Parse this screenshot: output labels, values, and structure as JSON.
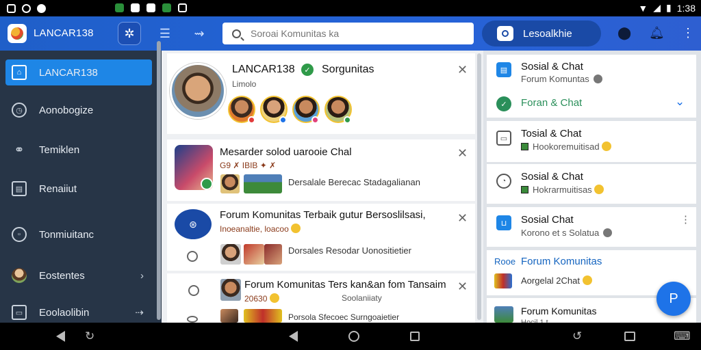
{
  "status_bar": {
    "time": "1:38"
  },
  "app_bar": {
    "title": "LANCAR138",
    "search_placeholder": "Soroai Komunitas ka",
    "pill_label": "Lesoalkhie"
  },
  "sidebar": {
    "items": [
      {
        "label": "LANCAR138",
        "icon": "home-icon",
        "active": true
      },
      {
        "label": "Aonobogize",
        "icon": "clock-icon"
      },
      {
        "label": "Temiklen",
        "icon": "link-icon"
      },
      {
        "label": "Renaiiut",
        "icon": "calendar-icon"
      },
      {
        "label": "Tonmiuitanc",
        "icon": "box-icon"
      },
      {
        "label": "Eostentes",
        "icon": "avatar",
        "chevron": "›"
      },
      {
        "label": "Eoolaolibin",
        "icon": "tablet-icon",
        "chevron": "⇢"
      }
    ]
  },
  "profile": {
    "name": "LANCAR138",
    "group": "Sorgunitas",
    "subtitle": "Limolo"
  },
  "posts": [
    {
      "title": "Mesarder solod uarooie Chal",
      "meta": "G9 ✗ IBIB ✦ ✗",
      "desc": "Dersalale Berecac Stadagalianan"
    },
    {
      "title": "Forum Komunitas Terbaik gutur Bersoslilsasi,",
      "meta": "Inoeanaltie, loacoo",
      "desc": "Dorsales Resodar Uonositietier"
    },
    {
      "title": "Forum Komunitas Ters kan&an fom Tansaim",
      "meta": "20630",
      "meta2": "Soolaniiaty",
      "desc": "Porsola Sfecoec Surngoaietier"
    }
  ],
  "right_panel": {
    "card1": {
      "title": "Sosial & Chat",
      "sub": "Forum Komuntas",
      "link": "Foran & Chat"
    },
    "card2": {
      "title": "Tosial & Chat",
      "sub": "Hookoremuitisad"
    },
    "card3": {
      "title": "Sosial & Chat",
      "sub": "Hokrarmuitisas"
    },
    "card4": {
      "title": "Sosial Chat",
      "sub": "Korono et s Solatua"
    },
    "card5": {
      "prefix": "Rooe",
      "title": "Forum Komunitas",
      "sub": "Aorgelal 2Chat"
    },
    "card6": {
      "title": "Forum Komunitas",
      "sub": "Hocil 1 t"
    }
  },
  "colors": {
    "appbar": "#2563d8",
    "sidebar": "#273547",
    "active_item": "#1e86e6",
    "fab": "#1e73e8",
    "link_green": "#2a8f5a",
    "link_blue": "#1565c0"
  }
}
